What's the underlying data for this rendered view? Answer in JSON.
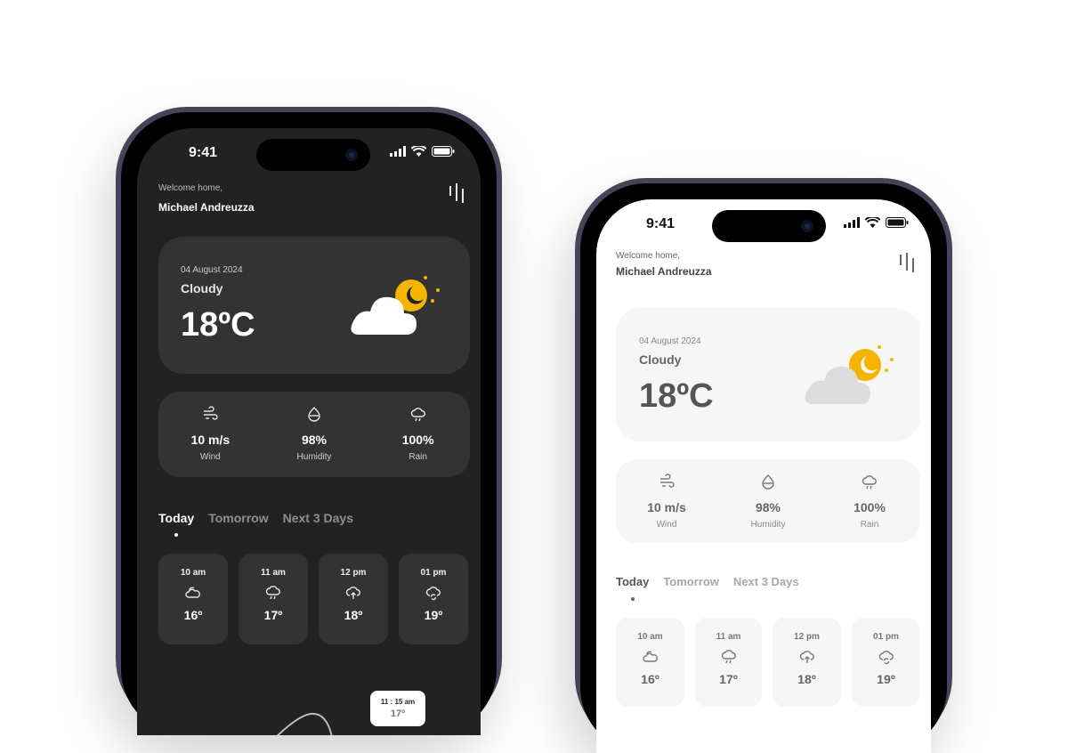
{
  "status_bar": {
    "time": "9:41"
  },
  "greeting": {
    "welcome": "Welcome home,",
    "name": "Michael Andreuzza"
  },
  "current": {
    "date": "04 August 2024",
    "condition": "Cloudy",
    "temperature": "18ºC",
    "icon": "cloudy-night-icon"
  },
  "stats": [
    {
      "value": "10 m/s",
      "label": "Wind",
      "icon": "wind-icon"
    },
    {
      "value": "98%",
      "label": "Humidity",
      "icon": "humidity-icon"
    },
    {
      "value": "100%",
      "label": "Rain",
      "icon": "rain-icon"
    }
  ],
  "tabs": [
    {
      "label": "Today",
      "active": true
    },
    {
      "label": "Tomorrow",
      "active": false
    },
    {
      "label": "Next 3 Days",
      "active": false
    }
  ],
  "hourly": [
    {
      "time": "10 am",
      "temp": "16º",
      "icon": "partly-cloudy-icon"
    },
    {
      "time": "11 am",
      "temp": "17º",
      "icon": "cloud-rain-icon"
    },
    {
      "time": "12 pm",
      "temp": "18º",
      "icon": "cloud-upload-icon"
    },
    {
      "time": "01 pm",
      "temp": "19º",
      "icon": "cloud-sync-icon"
    }
  ],
  "chart_tooltip": {
    "time": "11 : 15 am",
    "temp": "17º"
  },
  "colors": {
    "dark_bg": "#222222",
    "dark_card": "#333333",
    "light_card": "#f6f6f6",
    "sun": "#f5b400",
    "frame": "#4a4358"
  }
}
